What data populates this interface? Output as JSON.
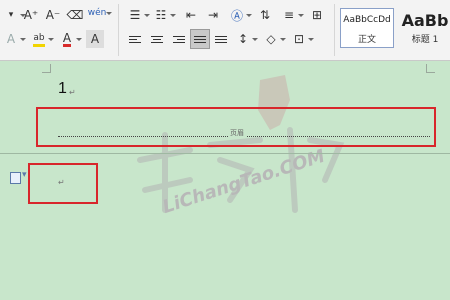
{
  "ribbon": {
    "font_grow": "A⁺",
    "font_shrink": "A⁻",
    "clear_format": "⌫",
    "phonetic": "wén",
    "text_effect": "A",
    "highlight": "ab",
    "font_color": "A",
    "char_shading": "A",
    "styles": [
      {
        "sample": "AaBbCcDd",
        "name": "正文"
      },
      {
        "sample": "AaBb",
        "name": "标题 1"
      }
    ]
  },
  "document": {
    "header_number": "1",
    "header_label": "页眉",
    "paragraph_mark": "↵"
  },
  "watermark": {
    "text": "LiChangTao.COM"
  },
  "colors": {
    "doc_bg": "#c8e6cb",
    "highlight_box": "#d8262b",
    "ribbon_bg": "#f3f3f3"
  }
}
